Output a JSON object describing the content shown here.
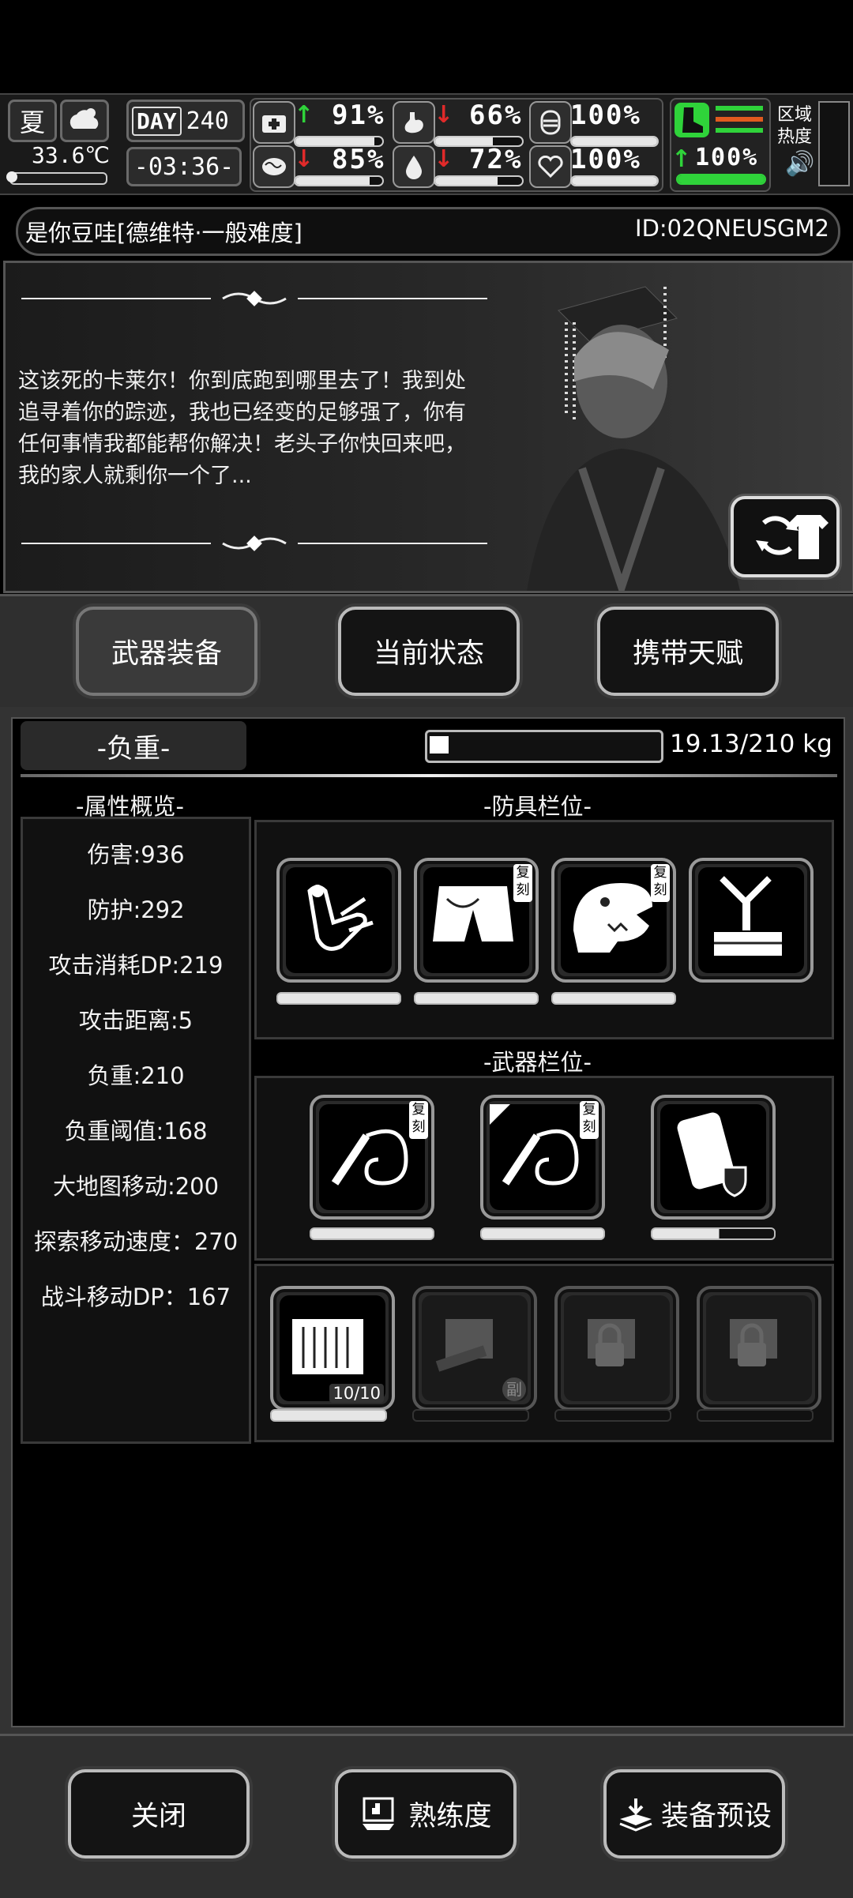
{
  "status": {
    "season": "夏",
    "temperature": "33.6℃",
    "day_label": "DAY",
    "day": "240",
    "clock": "-03:36-",
    "health": {
      "pct": "91%",
      "trend": "up",
      "fill": 0.91
    },
    "hunger": {
      "pct": "66%",
      "trend": "down",
      "fill": 0.66
    },
    "armor": {
      "pct": "100%",
      "fill": 1.0
    },
    "mood": {
      "pct": "85%",
      "trend": "down",
      "fill": 0.85
    },
    "thirst": {
      "pct": "72%",
      "trend": "down",
      "fill": 0.72
    },
    "heart": {
      "pct": "100%",
      "fill": 1.0
    },
    "stamina": {
      "pct": "100%",
      "trend": "up",
      "fill": 1.0
    },
    "zone_label_1": "区域",
    "zone_label_2": "热度"
  },
  "header": {
    "player": "是你豆哇[德维特·一般难度]",
    "id": "ID:02QNEUSGM2"
  },
  "story": {
    "text": "这该死的卡莱尔！你到底跑到哪里去了！我到处追寻着你的踪迹，我也已经变的足够强了，你有任何事情我都能帮你解决！老头子你快回来吧，我的家人就剩你一个了..."
  },
  "tabs": [
    {
      "label": "武器装备",
      "active": true
    },
    {
      "label": "当前状态",
      "active": false
    },
    {
      "label": "携带天赋",
      "active": false
    }
  ],
  "weight": {
    "label": "-负重-",
    "value": "19.13/210 kg",
    "fill": 0.09
  },
  "attributes": {
    "title": "-属性概览-",
    "items": [
      "伤害:936",
      "防护:292",
      "攻击消耗DP:219",
      "攻击距离:5",
      "负重:210",
      "负重阈值:168",
      "大地图移动:200",
      "探索移动速度：270",
      "战斗移动DP：167"
    ]
  },
  "armor_slots": {
    "title": "-防具栏位-",
    "items": [
      {
        "icon": "skeleton-hand-icon",
        "badge": "",
        "durability": 1.0
      },
      {
        "icon": "shorts-icon",
        "badge": "复刻",
        "durability": 1.0
      },
      {
        "icon": "dinosaur-head-icon",
        "badge": "复刻",
        "durability": 1.0
      },
      {
        "icon": "backpack-frame-icon",
        "badge": "",
        "durability": 1.0
      }
    ]
  },
  "weapon_slots": {
    "title": "-武器栏位-",
    "items": [
      {
        "icon": "whip-icon",
        "badge": "复刻",
        "durability": 1.0
      },
      {
        "icon": "whip-icon",
        "badge": "复刻",
        "durability": 1.0
      },
      {
        "icon": "shield-case-icon",
        "badge": "",
        "durability": 0.55
      }
    ]
  },
  "extra_slots": {
    "items": [
      {
        "icon": "ammo-crate-icon",
        "count": "10/10",
        "locked": false
      },
      {
        "icon": "fist-icon",
        "sub": "副",
        "locked": false
      },
      {
        "icon": "lock-icon",
        "locked": true
      },
      {
        "icon": "lock-icon",
        "locked": true
      }
    ]
  },
  "bottom_buttons": {
    "close": "关闭",
    "proficiency": "熟练度",
    "preset": "装备预设"
  }
}
